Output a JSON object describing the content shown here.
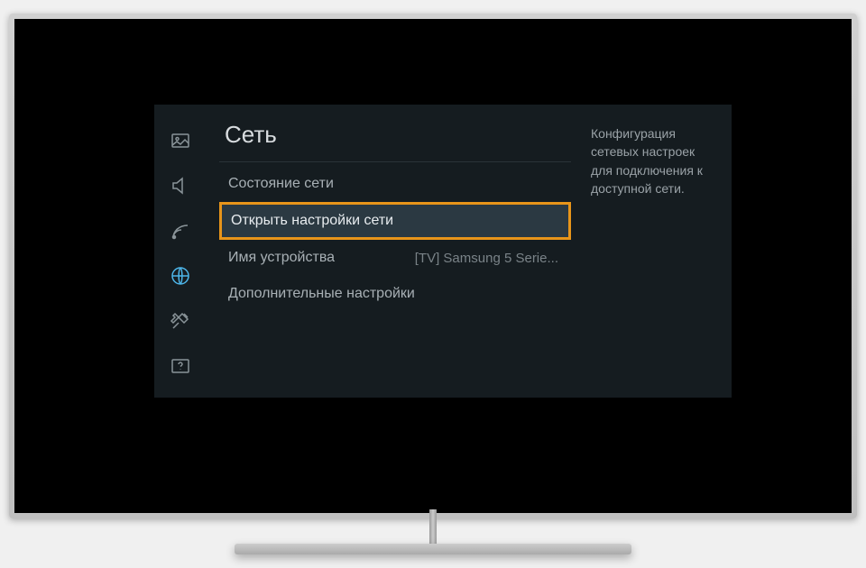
{
  "section_title": "Сеть",
  "description": "Конфигурация сетевых настроек для подключения к доступной сети.",
  "sidebar": {
    "items": [
      {
        "name": "picture",
        "active": false
      },
      {
        "name": "sound",
        "active": false
      },
      {
        "name": "broadcast",
        "active": false
      },
      {
        "name": "network",
        "active": true
      },
      {
        "name": "system",
        "active": false
      },
      {
        "name": "support",
        "active": false
      }
    ]
  },
  "menu": {
    "items": [
      {
        "label": "Состояние сети",
        "value": "",
        "highlighted": false
      },
      {
        "label": "Открыть настройки сети",
        "value": "",
        "highlighted": true
      },
      {
        "label": "Имя устройства",
        "value": "[TV] Samsung 5 Serie...",
        "highlighted": false
      },
      {
        "label": "Дополнительные настройки",
        "value": "",
        "highlighted": false
      }
    ]
  }
}
